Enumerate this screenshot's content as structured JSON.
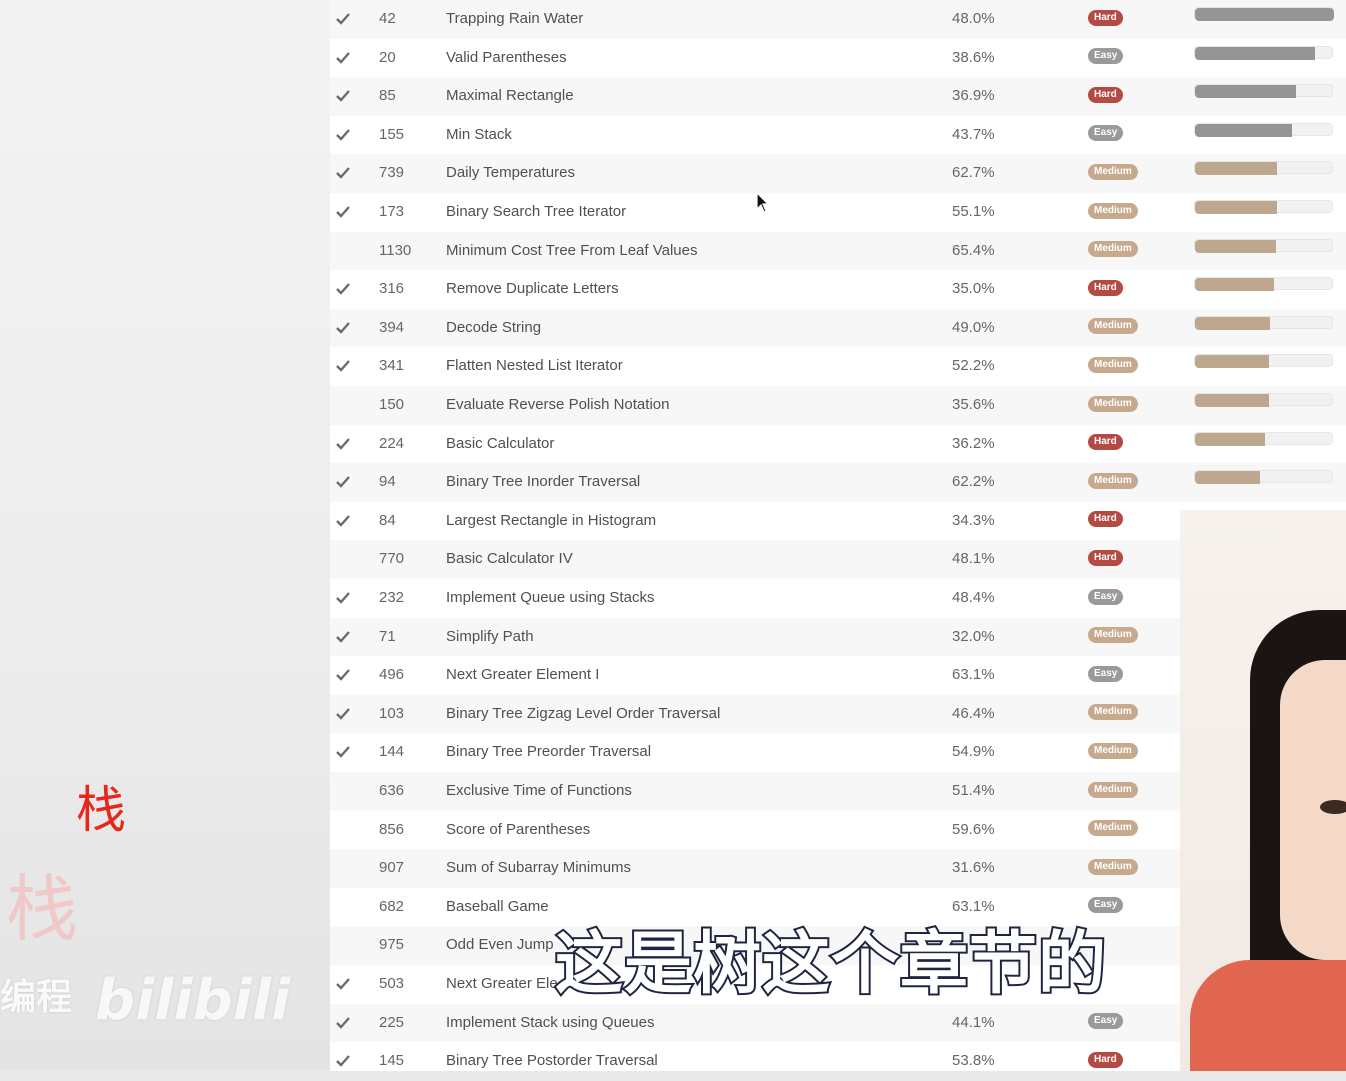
{
  "section_label": "栈",
  "ghost_label": "栈",
  "watermark": {
    "text": "编程",
    "logo": "bilibili"
  },
  "subtitle": "这是树这个章节的",
  "problems": [
    {
      "solved": true,
      "id": "42",
      "title": "Trapping Rain Water",
      "acceptance": "48.0%",
      "difficulty": "Hard",
      "frequency": 1.0
    },
    {
      "solved": true,
      "id": "20",
      "title": "Valid Parentheses",
      "acceptance": "38.6%",
      "difficulty": "Easy",
      "frequency": 0.86
    },
    {
      "solved": true,
      "id": "85",
      "title": "Maximal Rectangle",
      "acceptance": "36.9%",
      "difficulty": "Hard",
      "frequency": 0.73
    },
    {
      "solved": true,
      "id": "155",
      "title": "Min Stack",
      "acceptance": "43.7%",
      "difficulty": "Easy",
      "frequency": 0.7
    },
    {
      "solved": true,
      "id": "739",
      "title": "Daily Temperatures",
      "acceptance": "62.7%",
      "difficulty": "Medium",
      "frequency": 0.59
    },
    {
      "solved": true,
      "id": "173",
      "title": "Binary Search Tree Iterator",
      "acceptance": "55.1%",
      "difficulty": "Medium",
      "frequency": 0.59
    },
    {
      "solved": false,
      "id": "1130",
      "title": "Minimum Cost Tree From Leaf Values",
      "acceptance": "65.4%",
      "difficulty": "Medium",
      "frequency": 0.58
    },
    {
      "solved": true,
      "id": "316",
      "title": "Remove Duplicate Letters",
      "acceptance": "35.0%",
      "difficulty": "Hard",
      "frequency": 0.57
    },
    {
      "solved": true,
      "id": "394",
      "title": "Decode String",
      "acceptance": "49.0%",
      "difficulty": "Medium",
      "frequency": 0.54
    },
    {
      "solved": true,
      "id": "341",
      "title": "Flatten Nested List Iterator",
      "acceptance": "52.2%",
      "difficulty": "Medium",
      "frequency": 0.53
    },
    {
      "solved": false,
      "id": "150",
      "title": "Evaluate Reverse Polish Notation",
      "acceptance": "35.6%",
      "difficulty": "Medium",
      "frequency": 0.53
    },
    {
      "solved": true,
      "id": "224",
      "title": "Basic Calculator",
      "acceptance": "36.2%",
      "difficulty": "Hard",
      "frequency": 0.5
    },
    {
      "solved": true,
      "id": "94",
      "title": "Binary Tree Inorder Traversal",
      "acceptance": "62.2%",
      "difficulty": "Medium",
      "frequency": 0.47
    },
    {
      "solved": true,
      "id": "84",
      "title": "Largest Rectangle in Histogram",
      "acceptance": "34.3%",
      "difficulty": "Hard",
      "frequency": null
    },
    {
      "solved": false,
      "id": "770",
      "title": "Basic Calculator IV",
      "acceptance": "48.1%",
      "difficulty": "Hard",
      "frequency": null
    },
    {
      "solved": true,
      "id": "232",
      "title": "Implement Queue using Stacks",
      "acceptance": "48.4%",
      "difficulty": "Easy",
      "frequency": null
    },
    {
      "solved": true,
      "id": "71",
      "title": "Simplify Path",
      "acceptance": "32.0%",
      "difficulty": "Medium",
      "frequency": null
    },
    {
      "solved": true,
      "id": "496",
      "title": "Next Greater Element I",
      "acceptance": "63.1%",
      "difficulty": "Easy",
      "frequency": null
    },
    {
      "solved": true,
      "id": "103",
      "title": "Binary Tree Zigzag Level Order Traversal",
      "acceptance": "46.4%",
      "difficulty": "Medium",
      "frequency": null
    },
    {
      "solved": true,
      "id": "144",
      "title": "Binary Tree Preorder Traversal",
      "acceptance": "54.9%",
      "difficulty": "Medium",
      "frequency": null
    },
    {
      "solved": false,
      "id": "636",
      "title": "Exclusive Time of Functions",
      "acceptance": "51.4%",
      "difficulty": "Medium",
      "frequency": null
    },
    {
      "solved": false,
      "id": "856",
      "title": "Score of Parentheses",
      "acceptance": "59.6%",
      "difficulty": "Medium",
      "frequency": null
    },
    {
      "solved": false,
      "id": "907",
      "title": "Sum of Subarray Minimums",
      "acceptance": "31.6%",
      "difficulty": "Medium",
      "frequency": null
    },
    {
      "solved": false,
      "id": "682",
      "title": "Baseball Game",
      "acceptance": "63.1%",
      "difficulty": "Easy",
      "frequency": null
    },
    {
      "solved": false,
      "id": "975",
      "title": "Odd Even Jump",
      "acceptance": "",
      "difficulty": "",
      "frequency": null
    },
    {
      "solved": true,
      "id": "503",
      "title": "Next Greater Ele",
      "acceptance": "",
      "difficulty": "",
      "frequency": null
    },
    {
      "solved": true,
      "id": "225",
      "title": "Implement Stack using Queues",
      "acceptance": "44.1%",
      "difficulty": "Easy",
      "frequency": null
    },
    {
      "solved": true,
      "id": "145",
      "title": "Binary Tree Postorder Traversal",
      "acceptance": "53.8%",
      "difficulty": "Hard",
      "frequency": null
    }
  ]
}
